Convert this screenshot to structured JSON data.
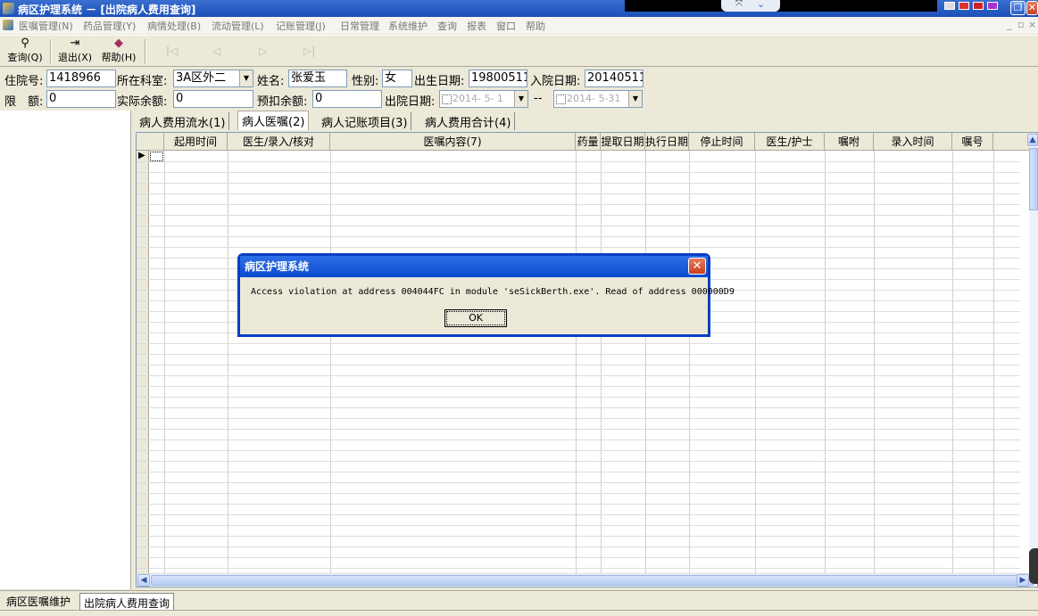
{
  "window": {
    "title": "病区护理系统 － [出院病人费用查询]",
    "controls": [
      "_",
      "❐",
      "✕"
    ]
  },
  "menu": {
    "items": [
      "医嘱管理(N)",
      "药品管理(Y)",
      "病情处理(B)",
      "流动管理(L)",
      "记账管理(J)",
      "日常管理",
      "系统维护",
      "查询",
      "报表",
      "窗口",
      "帮助"
    ],
    "mdi_controls": [
      "_",
      "▫",
      "×"
    ]
  },
  "toolbar": {
    "query_label": "查询(Q)",
    "exit_label": "退出(X)",
    "help_label": "帮助(H)",
    "nav": [
      "|◁",
      "◁",
      "▷",
      "▷|"
    ]
  },
  "form": {
    "inpatient_no_label": "住院号:",
    "inpatient_no": "1418966",
    "dept_label": "所在科室:",
    "dept": "3A区外二",
    "name_label": "姓名:",
    "name": "张爱玉",
    "sex_label": "性别:",
    "sex": "女",
    "birth_label": "出生日期:",
    "birth": "19800511",
    "admit_label": "入院日期:",
    "admit": "20140511",
    "limit_label": "限　额:",
    "limit": "0",
    "balance_label": "实际余额:",
    "balance": "0",
    "prepaid_label": "预扣余额:",
    "prepaid": "0",
    "discharge_label": "出院日期:",
    "discharge_from": "2014- 5- 1",
    "date_sep": "--",
    "discharge_to": "2014- 5-31"
  },
  "tabs": [
    {
      "label": "病人费用流水(1)"
    },
    {
      "label": "病人医嘱(2)"
    },
    {
      "label": "病人记账项目(3)"
    },
    {
      "label": "病人费用合计(4)"
    }
  ],
  "grid": {
    "columns": [
      "起用时间",
      "医生/录入/核对",
      "医嘱内容(7)",
      "药量",
      "提取日期",
      "执行日期",
      "停止时间",
      "医生/护士",
      "嘱咐",
      "录入时间",
      "嘱号"
    ],
    "current_row_marker": "▶"
  },
  "bottom_tabs": [
    "病区医嘱维护",
    "出院病人费用查询"
  ],
  "dialog": {
    "title": "病区护理系统",
    "message": "Access violation at address 004044FC in module 'seSickBerth.exe'. Read of address 000000D9",
    "ok_label": "OK",
    "close": "✕"
  }
}
